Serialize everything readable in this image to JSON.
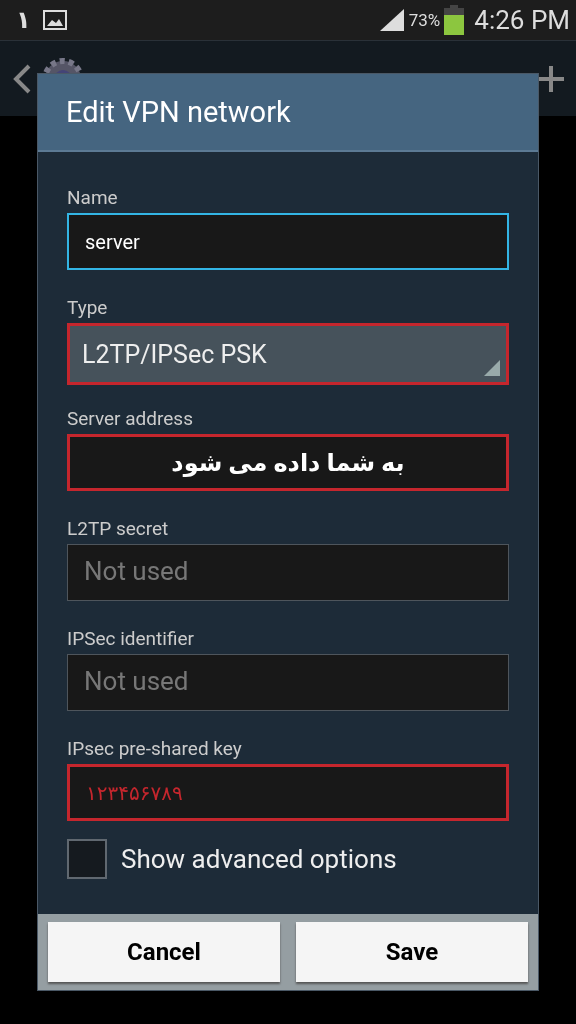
{
  "status_bar": {
    "notification": "١",
    "battery": "73%",
    "time": "4:26 PM"
  },
  "dialog": {
    "title": "Edit VPN network",
    "fields": [
      {
        "kind": "input",
        "label": "Name",
        "value": "server",
        "focused": true,
        "highlighted": false
      },
      {
        "kind": "select",
        "label": "Type",
        "value": "L2TP/IPSec PSK",
        "highlighted": true
      },
      {
        "kind": "input",
        "label": "Server address",
        "value": "به شما داده می شود",
        "bold": true,
        "focused": false,
        "highlighted": true
      },
      {
        "kind": "input",
        "label": "L2TP secret",
        "placeholder": "Not used",
        "focused": false,
        "highlighted": false
      },
      {
        "kind": "input",
        "label": "IPSec identifier",
        "placeholder": "Not used",
        "focused": false,
        "highlighted": false
      },
      {
        "kind": "input",
        "label": "IPsec pre-shared key",
        "value": "١٢٣۴۵۶٧٨٩",
        "color": "#c5262d",
        "focused": false,
        "highlighted": true
      },
      {
        "kind": "checkbox",
        "label": "Show advanced options",
        "checked": false
      }
    ],
    "buttons": [
      "Cancel",
      "Save"
    ]
  }
}
